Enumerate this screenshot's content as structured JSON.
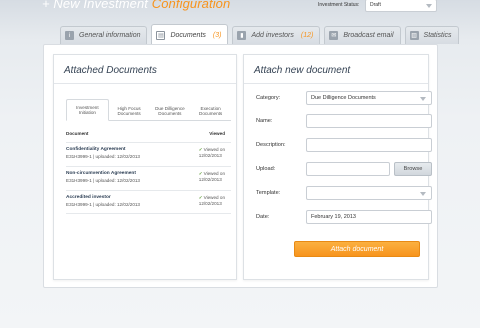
{
  "page": {
    "title_prefix": "+ New Investment ",
    "title_accent": "Configuration",
    "status_label": "Investment Status:",
    "status_value": "Draft"
  },
  "tabs": [
    {
      "label": "General information",
      "count": "",
      "icon": "info-icon"
    },
    {
      "label": "Documents",
      "count": "(3)",
      "icon": "document-icon",
      "active": true
    },
    {
      "label": "Add investors",
      "count": "(12)",
      "icon": "investors-icon"
    },
    {
      "label": "Broadcast email",
      "count": "",
      "icon": "email-icon"
    },
    {
      "label": "Statistics",
      "count": "",
      "icon": "statistics-icon"
    }
  ],
  "attached": {
    "title": "Attached Documents",
    "subtabs": [
      {
        "label": "Investment Initiation",
        "active": true
      },
      {
        "label": "High Focus Documents"
      },
      {
        "label": "Due Dilligence Documents"
      },
      {
        "label": "Execution Documents"
      }
    ],
    "col_document": "Document",
    "col_viewed": "Viewed",
    "rows": [
      {
        "name": "Confidentiality Agreement",
        "meta": "E31H3999-1  |  uploaded: 12/02/2013",
        "viewed_line1": "Viewed on",
        "viewed_line2": "12/02/2013"
      },
      {
        "name": "Non-circumvention Agreement",
        "meta": "E31H3999-1  |  uploaded: 12/02/2013",
        "viewed_line1": "Viewed on",
        "viewed_line2": "12/02/2013"
      },
      {
        "name": "Accredited investor",
        "meta": "E31H3999-1  |  uploaded: 12/02/2013",
        "viewed_line1": "Viewed on",
        "viewed_line2": "12/02/2013"
      }
    ]
  },
  "attach": {
    "title": "Attach new document",
    "category_label": "Category:",
    "category_value": "Due Dilligence Documents",
    "name_label": "Name:",
    "description_label": "Description:",
    "upload_label": "Upload:",
    "browse_label": "Browse",
    "template_label": "Template:",
    "date_label": "Date:",
    "date_value": "February 19, 2013",
    "submit_label": "Attach document"
  },
  "colors": {
    "accent": "#f7941d",
    "title_blue": "#354354",
    "check_green": "#5a9a2e"
  }
}
